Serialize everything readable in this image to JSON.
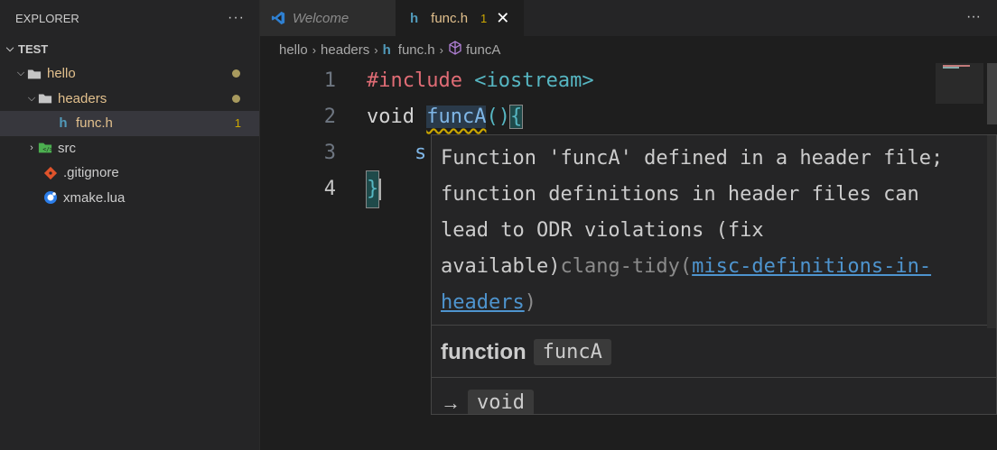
{
  "sidebar": {
    "title": "EXPLORER",
    "more": "···",
    "section": "TEST",
    "items": [
      {
        "label": "hello",
        "type": "folder",
        "expanded": true,
        "modified": true
      },
      {
        "label": "headers",
        "type": "folder",
        "expanded": true,
        "modified": true
      },
      {
        "label": "func.h",
        "type": "file",
        "icon": "h",
        "problems": "1"
      },
      {
        "label": "src",
        "type": "folder",
        "expanded": false
      },
      {
        "label": ".gitignore",
        "type": "file"
      },
      {
        "label": "xmake.lua",
        "type": "file"
      }
    ]
  },
  "tabs": [
    {
      "label": "Welcome",
      "active": false
    },
    {
      "label": "func.h",
      "icon": "h",
      "problems": "1",
      "active": true,
      "close": "✕"
    }
  ],
  "tab_more": "···",
  "breadcrumb": [
    "hello",
    "headers",
    "func.h",
    "funcA"
  ],
  "editor": {
    "lines": [
      {
        "num": "1",
        "tokens": [
          "#include",
          " <iostream>"
        ]
      },
      {
        "num": "2",
        "tokens": [
          "void",
          " ",
          "funcA",
          "()",
          "{"
        ]
      },
      {
        "num": "3",
        "tokens": [
          "    s"
        ]
      },
      {
        "num": "4",
        "tokens": [
          "}"
        ]
      }
    ]
  },
  "hover": {
    "message_lines": [
      "Function 'funcA' defined in a header file;",
      "function definitions in header files can",
      "lead to ODR violations (fix"
    ],
    "message_last": "available)",
    "source": "clang-tidy(",
    "link_part1": "misc-definitions-in-",
    "link_part2": "headers",
    "source_close": ")",
    "sig_kind": "function",
    "sig_name": "funcA",
    "ret_arrow": "→",
    "ret_type": "void"
  },
  "colors": {
    "modified": "#e2c08d",
    "problem_count": "#cca700",
    "link": "#4e94ce"
  }
}
